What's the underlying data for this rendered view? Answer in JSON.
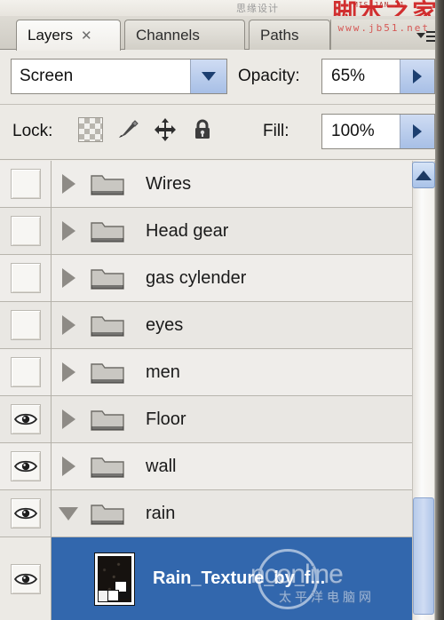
{
  "watermark": {
    "top_grey": "思缘设计",
    "top_red": "脚本之家",
    "top_red_small": "MIS JAN 21",
    "top_url": "www.jb51.net",
    "bottom_text": "nconline",
    "bottom_sub": "太平洋电脑网"
  },
  "tabs": [
    {
      "label": "Layers",
      "close": "✕",
      "active": true
    },
    {
      "label": "Channels",
      "close": "",
      "active": false
    },
    {
      "label": "Paths",
      "close": "",
      "active": false
    }
  ],
  "panel_menu": {
    "name": "panel-menu"
  },
  "blend": {
    "mode": "Screen",
    "opacity_label": "Opacity:",
    "opacity_value": "65%"
  },
  "lock": {
    "label": "Lock:",
    "icons": [
      "lock-transparent-pixels-icon",
      "lock-image-pixels-icon",
      "lock-position-icon",
      "lock-all-icon"
    ],
    "fill_label": "Fill:",
    "fill_value": "100%"
  },
  "layers": [
    {
      "name": "Wires",
      "visible": false,
      "type": "group",
      "expanded": false
    },
    {
      "name": "Head gear",
      "visible": false,
      "type": "group",
      "expanded": false
    },
    {
      "name": "gas cylender",
      "visible": false,
      "type": "group",
      "expanded": false
    },
    {
      "name": "eyes",
      "visible": false,
      "type": "group",
      "expanded": false
    },
    {
      "name": "men",
      "visible": false,
      "type": "group",
      "expanded": false
    },
    {
      "name": "Floor",
      "visible": true,
      "type": "group",
      "expanded": false
    },
    {
      "name": "wall",
      "visible": true,
      "type": "group",
      "expanded": false
    },
    {
      "name": "rain",
      "visible": true,
      "type": "group",
      "expanded": true
    },
    {
      "name": "Rain_Texture_by_f...",
      "visible": true,
      "type": "layer",
      "selected": true
    }
  ],
  "colors": {
    "selection_blue": "#3267ad",
    "panel_bg": "#eceae5",
    "accent_blue": "#a7bfe6"
  }
}
